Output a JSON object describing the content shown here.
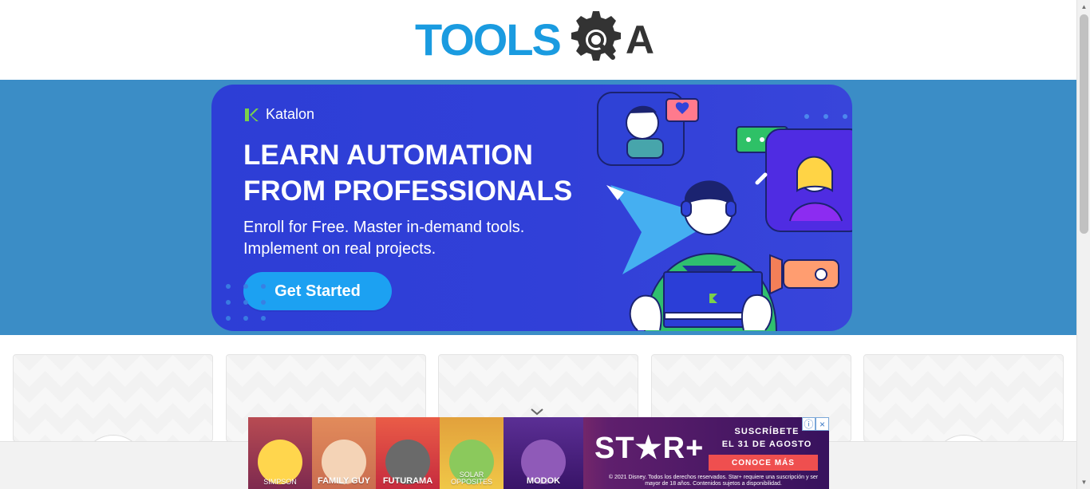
{
  "header": {
    "logo_text_left": "TOOLS",
    "logo_text_right": "A"
  },
  "promo": {
    "brand": "Katalon",
    "headline_line1": "LEARN AUTOMATION",
    "headline_line2": "FROM PROFESSIONALS",
    "subline_line1": "Enroll for Free. Master in-demand tools.",
    "subline_line2": "Implement on real projects.",
    "cta_label": "Get Started"
  },
  "ad": {
    "panels": [
      "SIMPSON",
      "FAMILY GUY",
      "FUTURAMA",
      "SOLAR OPPOSITES",
      "MODOK"
    ],
    "logo": "ST★R+",
    "copy_line1": "SUSCRÍBETE",
    "copy_line2": "EL 31 DE AGOSTO",
    "button": "CONOCE MÁS",
    "legal": "© 2021 Disney. Todos los derechos reservados. Star+ requiere una suscripción y ser mayor de 18 años. Contenidos sujetos a disponibilidad.",
    "info_icon": "ⓘ",
    "close_icon": "×"
  },
  "colors": {
    "brand_blue": "#1a9be0",
    "banner_band": "#3b8dc6",
    "promo_blue": "#3140d8",
    "cta_blue": "#1ca1f2",
    "ad_red": "#ef4f4f"
  },
  "icons": {
    "gear": "gear-icon",
    "magnifier": "search-icon",
    "katalon": "katalon-logo-icon",
    "chevron": "chevron-down-icon",
    "info": "info-icon",
    "close": "close-icon"
  }
}
